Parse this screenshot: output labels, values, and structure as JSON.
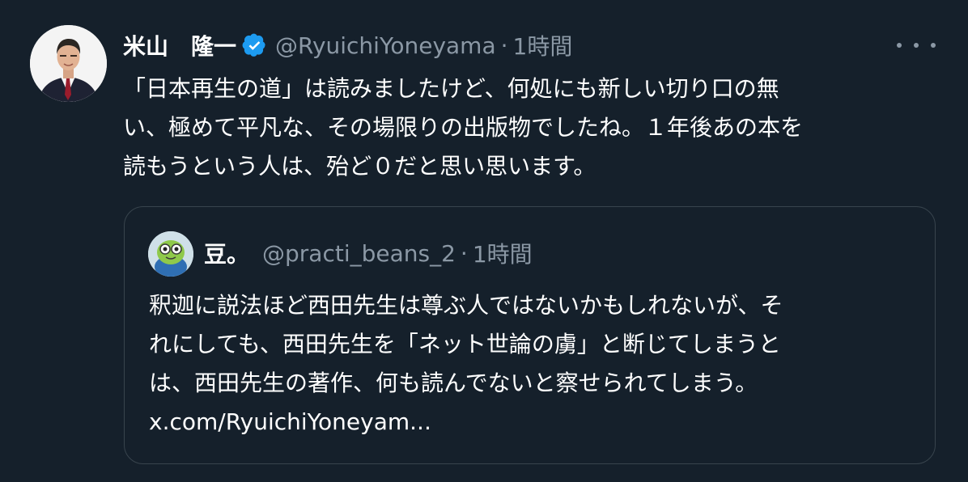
{
  "tweet": {
    "display_name": "米山　隆一",
    "handle": "@RyuichiYoneyama",
    "separator": "·",
    "time": "1時間",
    "verified_icon": "verified-badge-icon",
    "more_icon": "more-options-icon",
    "text_lines": [
      "「日本再生の道」は読みましたけど、何処にも新しい切り口の無",
      "い、極めて平凡な、その場限りの出版物でしたね。１年後あの本を",
      "読もうという人は、殆ど０だと思い思います。"
    ]
  },
  "quote": {
    "display_name": "豆。",
    "handle": "@practi_beans_2",
    "separator": "·",
    "time": "1時間",
    "text_lines": [
      "釈迦に説法ほど西田先生は尊ぶ人ではないかもしれないが、そ",
      "れにしても、西田先生を「ネット世論の虜」と断じてしまうと",
      "は、西田先生の著作、何も読んでないと察せられてしまう。",
      "x.com/RyuichiYoneyam..."
    ]
  },
  "colors": {
    "background": "#15202b",
    "text": "#ffffff",
    "secondary_text": "#8b98a5",
    "border": "#38444d",
    "verified": "#1d9bf0"
  }
}
